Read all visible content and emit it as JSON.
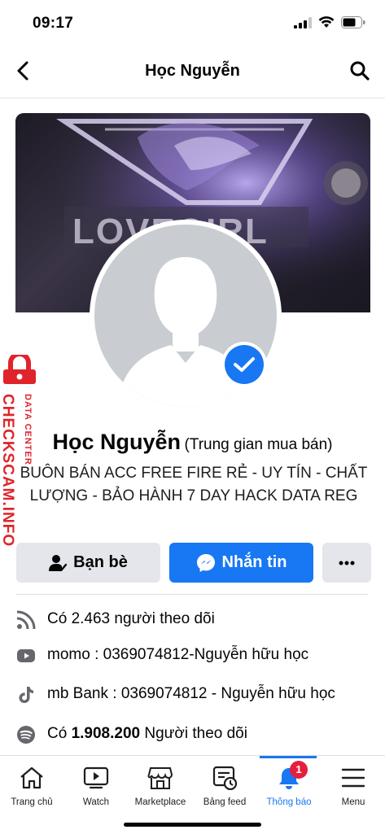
{
  "status": {
    "time": "09:17"
  },
  "nav": {
    "title": "Học Nguyễn"
  },
  "watermark": {
    "brand": "CHECKSCAM.INFO",
    "sub": "DATA CENTER"
  },
  "cover": {
    "text": "LOVEGIRL"
  },
  "profile": {
    "name": "Học Nguyễn",
    "subtitle": "(Trung gian mua bán)",
    "bio": "BUÔN BÁN ACC FREE FIRE RẺ - UY TÍN - CHẤT LƯỢNG - BẢO HÀNH 7 DAY HACK DATA REG"
  },
  "actions": {
    "friends_label": "Bạn bè",
    "message_label": "Nhắn tin"
  },
  "details": [
    {
      "icon": "rss-icon",
      "text": "Có 2.463 người theo dõi"
    },
    {
      "icon": "youtube-icon",
      "text": "momo : 0369074812-Nguyễn hữu học"
    },
    {
      "icon": "tiktok-icon",
      "text": "mb Bank : 0369074812 - Nguyễn hữu học"
    },
    {
      "icon": "spotify-icon",
      "text_prefix": "Có",
      "text_bold": "1.908.200",
      "text_suffix": "Người theo dõi"
    }
  ],
  "tabs": [
    {
      "label": "Trang chủ"
    },
    {
      "label": "Watch"
    },
    {
      "label": "Marketplace"
    },
    {
      "label": "Bảng feed"
    },
    {
      "label": "Thông báo",
      "badge": "1",
      "active": true
    },
    {
      "label": "Menu"
    }
  ],
  "colors": {
    "accent": "#1877f2",
    "badge": "#e41e3f",
    "watermark": "#e0242b"
  }
}
